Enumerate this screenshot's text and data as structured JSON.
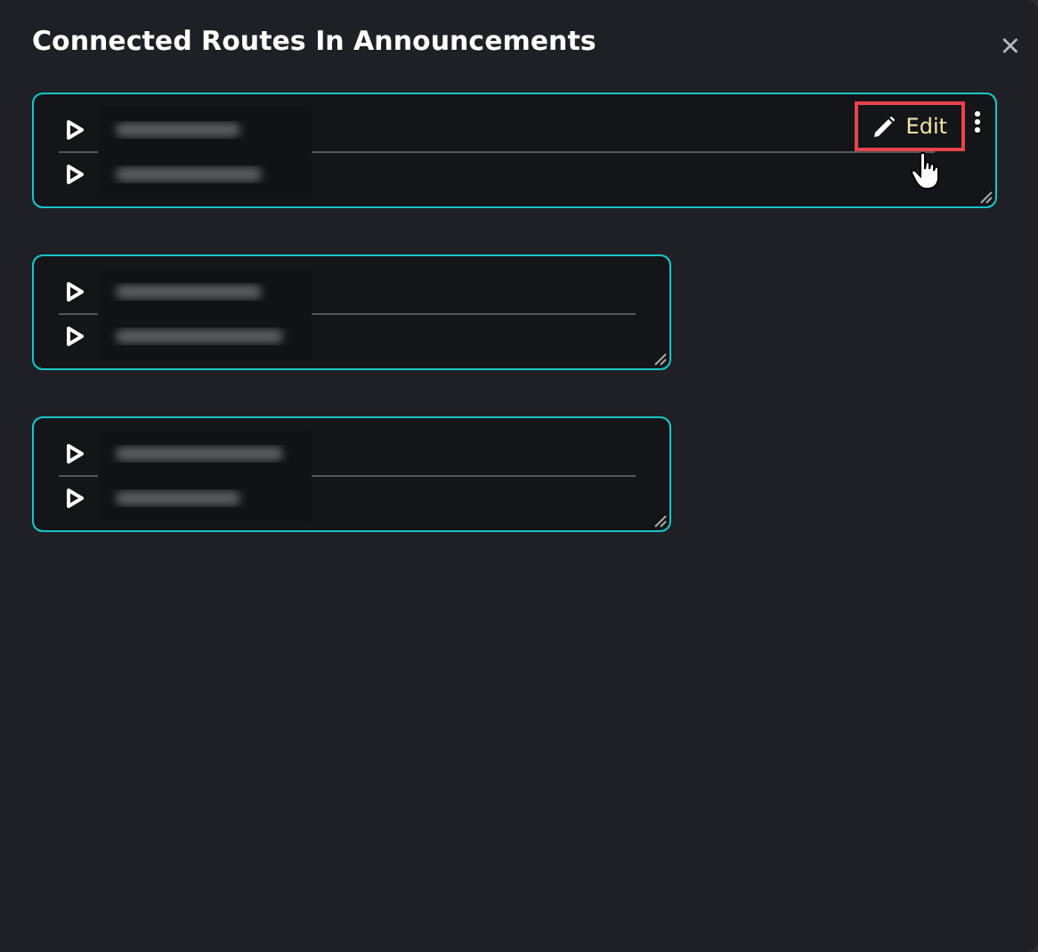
{
  "dialog": {
    "title": "Connected Routes In Announcements",
    "close": "×"
  },
  "routes": [
    {
      "hovered": true,
      "edit": {
        "label": "Edit",
        "highlighted": true
      },
      "rows": [
        {
          "kind": "redacted"
        },
        {
          "kind": "redacted"
        }
      ]
    },
    {
      "hovered": false,
      "rows": [
        {
          "kind": "redacted"
        },
        {
          "kind": "redacted"
        }
      ]
    },
    {
      "hovered": false,
      "rows": [
        {
          "kind": "redacted"
        },
        {
          "kind": "redacted"
        }
      ]
    }
  ]
}
